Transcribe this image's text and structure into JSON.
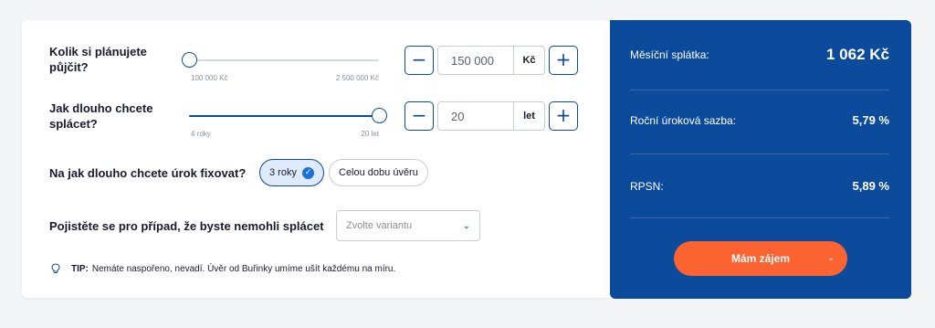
{
  "loan_amount": {
    "label": "Kolik si plánujete půjčit?",
    "slider_min": "100 000 Kč",
    "slider_max": "2 500 000 Kč",
    "slider_level": 0.0,
    "value": "150 000",
    "unit": "Kč",
    "minus": "−",
    "plus": "+"
  },
  "duration": {
    "label": "Jak dlouho chcete splácet?",
    "slider_min": "4 roky",
    "slider_max": "20 let",
    "slider_level": 1.0,
    "value": "20",
    "unit": "let",
    "minus": "−",
    "plus": "+"
  },
  "fixation": {
    "label": "Na jak dlouho chcete úrok fixovat?",
    "options": [
      "3 roky",
      "Celou dobu úvěru"
    ],
    "selected": "3 roky",
    "check": "✓"
  },
  "insurance": {
    "label": "Pojistěte se pro případ, že byste nemohli splácet",
    "placeholder": "Zvolte variantu",
    "chevron": "⌄"
  },
  "tip": {
    "icon": "lightbulb-icon",
    "prefix": "TIP:",
    "text": "Nemáte naspořeno, nevadí. Úvěr od Buřinky umíme ušít každému na míru."
  },
  "summary": {
    "rows": [
      {
        "label": "Měsíční splátka:",
        "value": "1 062 Kč"
      },
      {
        "label": "Roční úroková sazba:",
        "value": "5,79 %"
      },
      {
        "label": "RPSN:",
        "value": "5,89 %"
      }
    ],
    "cta": "Mám zájem",
    "cta_chevron": "⌄"
  },
  "colors": {
    "brand_blue": "#0c4a9c",
    "accent_orange": "#fb6331",
    "chip_active_bg": "#dfeafb"
  }
}
